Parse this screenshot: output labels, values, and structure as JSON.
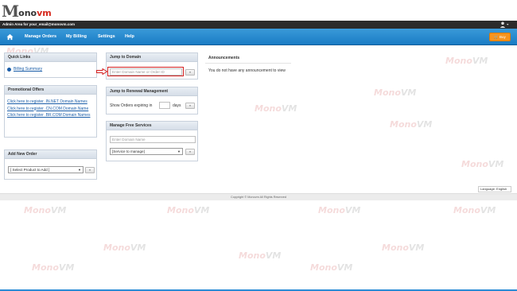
{
  "brand": {
    "logo_m": "M",
    "logo_text_a": "ono",
    "logo_text_b": "vm"
  },
  "admin_bar": {
    "label": "Admin Area for your_email@monovm.com"
  },
  "nav": {
    "items": [
      {
        "label": "Manage Orders"
      },
      {
        "label": "My Billing"
      },
      {
        "label": "Settings"
      },
      {
        "label": "Help"
      }
    ],
    "cart_label": "Buy"
  },
  "quick_links": {
    "title": "Quick Links",
    "billing_summary": "Billing Summary"
  },
  "promo": {
    "title": "Promotional Offers",
    "links": [
      "Click here to register .IN.NET Domain Names",
      "Click here to register .CN.COM Domain Name",
      "Click here to register .BR.COM Domain Names"
    ]
  },
  "add_order": {
    "title": "Add New Order",
    "select_value": "[ Select Product to Add ]",
    "go_label": "»"
  },
  "jump_domain": {
    "title": "Jump to Domain",
    "placeholder": "Enter Domain Name or Order ID",
    "go_label": "»"
  },
  "renewal": {
    "title": "Jump to Renewal Management",
    "prefix": "Show Orders expiring in",
    "suffix": "days",
    "go_label": "»"
  },
  "free_services": {
    "title": "Manage Free Services",
    "placeholder": "Enter Domain Name",
    "select_value": "[Service to manage]",
    "go_label": "»"
  },
  "announcements": {
    "title": "Announcements",
    "text": "You do not have any announcement to view"
  },
  "language": {
    "label": "Language:",
    "value": "English"
  },
  "footer": {
    "text": "Copyright © Monovm All Rights Reserved"
  },
  "watermark": {
    "a": "Mono",
    "b": "VM"
  },
  "colors": {
    "nav": "#1a7cc4",
    "accent": "#f7941d",
    "highlight": "#d32020"
  }
}
